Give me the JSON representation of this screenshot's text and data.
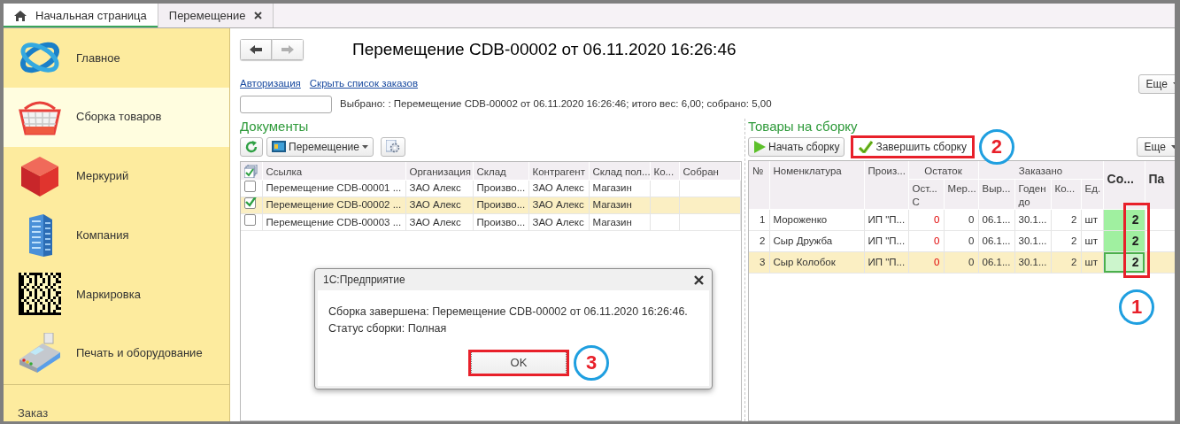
{
  "tabs": [
    {
      "label": "Начальная страница",
      "selected": true,
      "kind": "home"
    },
    {
      "label": "Перемещение",
      "selected": false,
      "kind": "closable"
    }
  ],
  "sidebar": {
    "items": [
      {
        "label": "Главное",
        "selected": false,
        "kind": "orbit"
      },
      {
        "label": "Сборка товаров",
        "selected": true,
        "kind": "basket"
      },
      {
        "label": "Меркурий",
        "selected": false,
        "kind": "cube"
      },
      {
        "label": "Компания",
        "selected": false,
        "kind": "building"
      },
      {
        "label": "Маркировка",
        "selected": false,
        "kind": "datamatrix"
      },
      {
        "label": "Печать и оборудование",
        "selected": false,
        "kind": "terminal"
      }
    ],
    "footer": "Заказ"
  },
  "form": {
    "nav_buttons": [
      {
        "kind": "back",
        "disabled": false
      },
      {
        "kind": "forward",
        "disabled": true
      }
    ],
    "title": "Перемещение CDB-00002 от 06.11.2020 16:26:46",
    "links": [
      "Авторизация",
      "Скрыть список заказов"
    ],
    "more_button": "Еще",
    "selection_info": "Выбрано: : Перемещение CDB-00002 от 06.11.2020 16:26:46; итого вес: 6,00; собрано: 5,00"
  },
  "documents": {
    "heading": "Документы",
    "toolbar": [
      {
        "kind": "refresh"
      },
      {
        "kind": "dropdown",
        "label": "Перемещение"
      },
      {
        "kind": "settings"
      }
    ],
    "columns": [
      "Ссылка",
      "Организация",
      "Склад",
      "Контрагент",
      "Склад пол...",
      "Ко...",
      "Собран"
    ],
    "rows": [
      {
        "checked": false,
        "selected": false,
        "cells": [
          "Перемещение CDB-00001 ...",
          "ЗАО Алекс",
          "Произво...",
          "ЗАО Алекс",
          "Магазин"
        ]
      },
      {
        "checked": true,
        "selected": true,
        "cells": [
          "Перемещение CDB-00002 ...",
          "ЗАО Алекс",
          "Произво...",
          "ЗАО Алекс",
          "Магазин"
        ]
      },
      {
        "checked": false,
        "selected": false,
        "cells": [
          "Перемещение CDB-00003 ...",
          "ЗАО Алекс",
          "Произво...",
          "ЗАО Алекс",
          "Магазин"
        ]
      }
    ]
  },
  "goods": {
    "heading": "Товары на сборку",
    "buttons": [
      {
        "kind": "start",
        "label": "Начать сборку"
      },
      {
        "kind": "finish",
        "label": "Завершить сборку",
        "callout": "2"
      }
    ],
    "more_button": "Еще",
    "columns": [
      {
        "label": "№"
      },
      {
        "label": "Номенклатура"
      },
      {
        "label": "Произ..."
      },
      {
        "label": "Остаток",
        "colspan": 2,
        "children": [
          {
            "label": "Ост... С"
          },
          {
            "label": "Мер..."
          }
        ]
      },
      {
        "label": "Заказано",
        "colspan": 4,
        "children": [
          {
            "label": "Выр..."
          },
          {
            "label": "Годен до"
          },
          {
            "label": "Ко..."
          },
          {
            "label": "Ед."
          }
        ]
      },
      {
        "label": "Со...",
        "callout": "1"
      },
      {
        "label": "Па"
      }
    ],
    "rows": [
      {
        "selected": false,
        "stock_short": true,
        "complete": true,
        "cells": [
          "1",
          "Мороженко",
          "ИП \"П...",
          "0",
          "0",
          "06.1...",
          "30.1...",
          "2",
          "шт"
        ],
        "collected": "2"
      },
      {
        "selected": false,
        "stock_short": true,
        "complete": true,
        "cells": [
          "2",
          "Сыр Дружба",
          "ИП \"П...",
          "0",
          "0",
          "06.1...",
          "30.1...",
          "2",
          "шт"
        ],
        "collected": "2"
      },
      {
        "selected": true,
        "stock_short": true,
        "complete": true,
        "cells": [
          "3",
          "Сыр Колобок",
          "ИП \"П...",
          "0",
          "0",
          "06.1...",
          "30.1...",
          "2",
          "шт"
        ],
        "collected": "2"
      }
    ]
  },
  "dialog": {
    "title": "1С:Предприятие",
    "message": [
      "Сборка завершена: Перемещение CDB-00002 от 06.11.2020 16:26:46.",
      "Статус сборки: Полная"
    ],
    "button": "OK",
    "callout": "3"
  }
}
